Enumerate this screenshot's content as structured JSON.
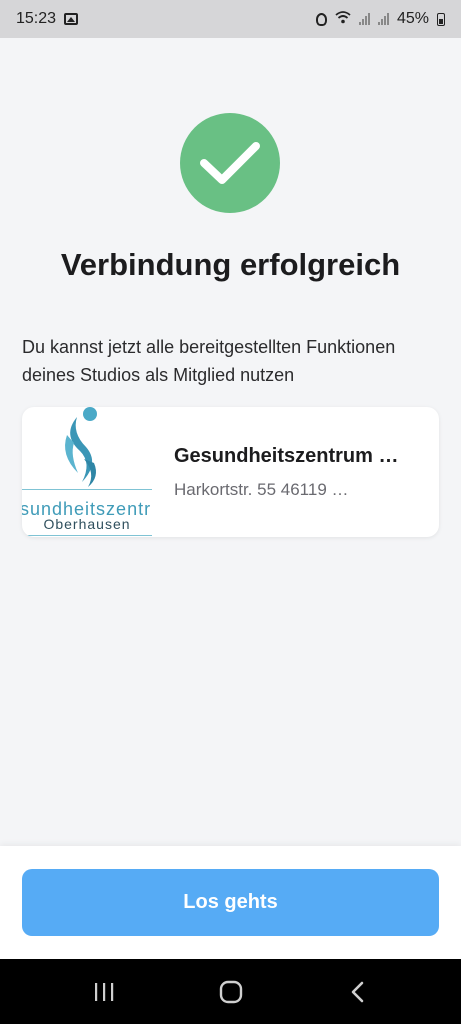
{
  "status_bar": {
    "time": "15:23",
    "battery": "45%",
    "icons": [
      "gallery-icon",
      "alarm-icon",
      "wifi-icon",
      "signal-icon",
      "battery-icon"
    ]
  },
  "success": {
    "icon": "checkmark-icon",
    "color": "#69c084",
    "title": "Verbindung erfolgreich",
    "description": "Du kannst jetzt alle bereitgestellten Funktionen deines Studios als Mitglied nutzen"
  },
  "studio": {
    "logo_text": "sundheitszentr",
    "logo_subtext": "Oberhausen",
    "name": "Gesundheitszentrum …",
    "address": "Harkortstr. 55 46119 …"
  },
  "actions": {
    "primary_label": "Los gehts",
    "primary_color": "#56abf5"
  },
  "nav": {
    "items": [
      "recents-icon",
      "home-icon",
      "back-icon"
    ]
  }
}
